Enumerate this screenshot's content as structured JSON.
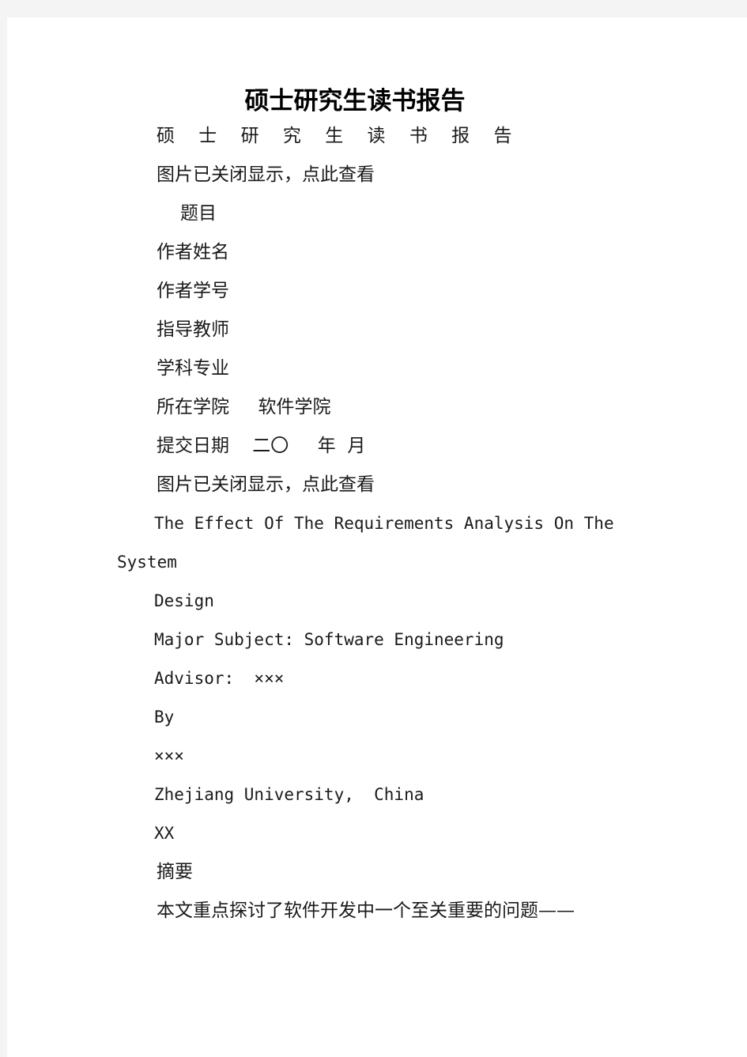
{
  "page": {
    "background_color": "#f4f4f4",
    "paper_color": "#ffffff",
    "text_color": "#1a1a1a"
  },
  "document": {
    "title": "硕士研究生读书报告",
    "lines": [
      {
        "id": "heading_spaced",
        "text": "硕 士 研 究 生 读 书 报 告"
      },
      {
        "id": "image_notice_top",
        "text": "图片已关闭显示，点此查看"
      },
      {
        "id": "field_subject",
        "text": "题目"
      },
      {
        "id": "field_author_name",
        "text": "作者姓名"
      },
      {
        "id": "field_author_id",
        "text": "作者学号"
      },
      {
        "id": "field_advisor",
        "text": "指导教师"
      },
      {
        "id": "field_major",
        "text": "学科专业"
      },
      {
        "id": "field_college",
        "text": "所在学院     软件学院"
      },
      {
        "id": "field_submit_date",
        "text": "提交日期    二〇     年  月"
      },
      {
        "id": "image_notice_bottom",
        "text": "图片已关闭显示，点此查看"
      },
      {
        "id": "en_title_line1",
        "text": "The Effect Of The Requirements Analysis On The"
      },
      {
        "id": "en_title_line2",
        "text": "System"
      },
      {
        "id": "en_title_line3",
        "text": "Design"
      },
      {
        "id": "en_major",
        "text": "Major Subject: Software Engineering"
      },
      {
        "id": "en_advisor",
        "text": "Advisor:  ×××"
      },
      {
        "id": "en_by",
        "text": "By"
      },
      {
        "id": "en_author",
        "text": "×××"
      },
      {
        "id": "en_university",
        "text": "Zhejiang University,  China"
      },
      {
        "id": "en_year",
        "text": "XX"
      },
      {
        "id": "abstract_heading",
        "text": "摘要"
      },
      {
        "id": "abstract_line1",
        "text": "本文重点探讨了软件开发中一个至关重要的问题——"
      }
    ]
  }
}
